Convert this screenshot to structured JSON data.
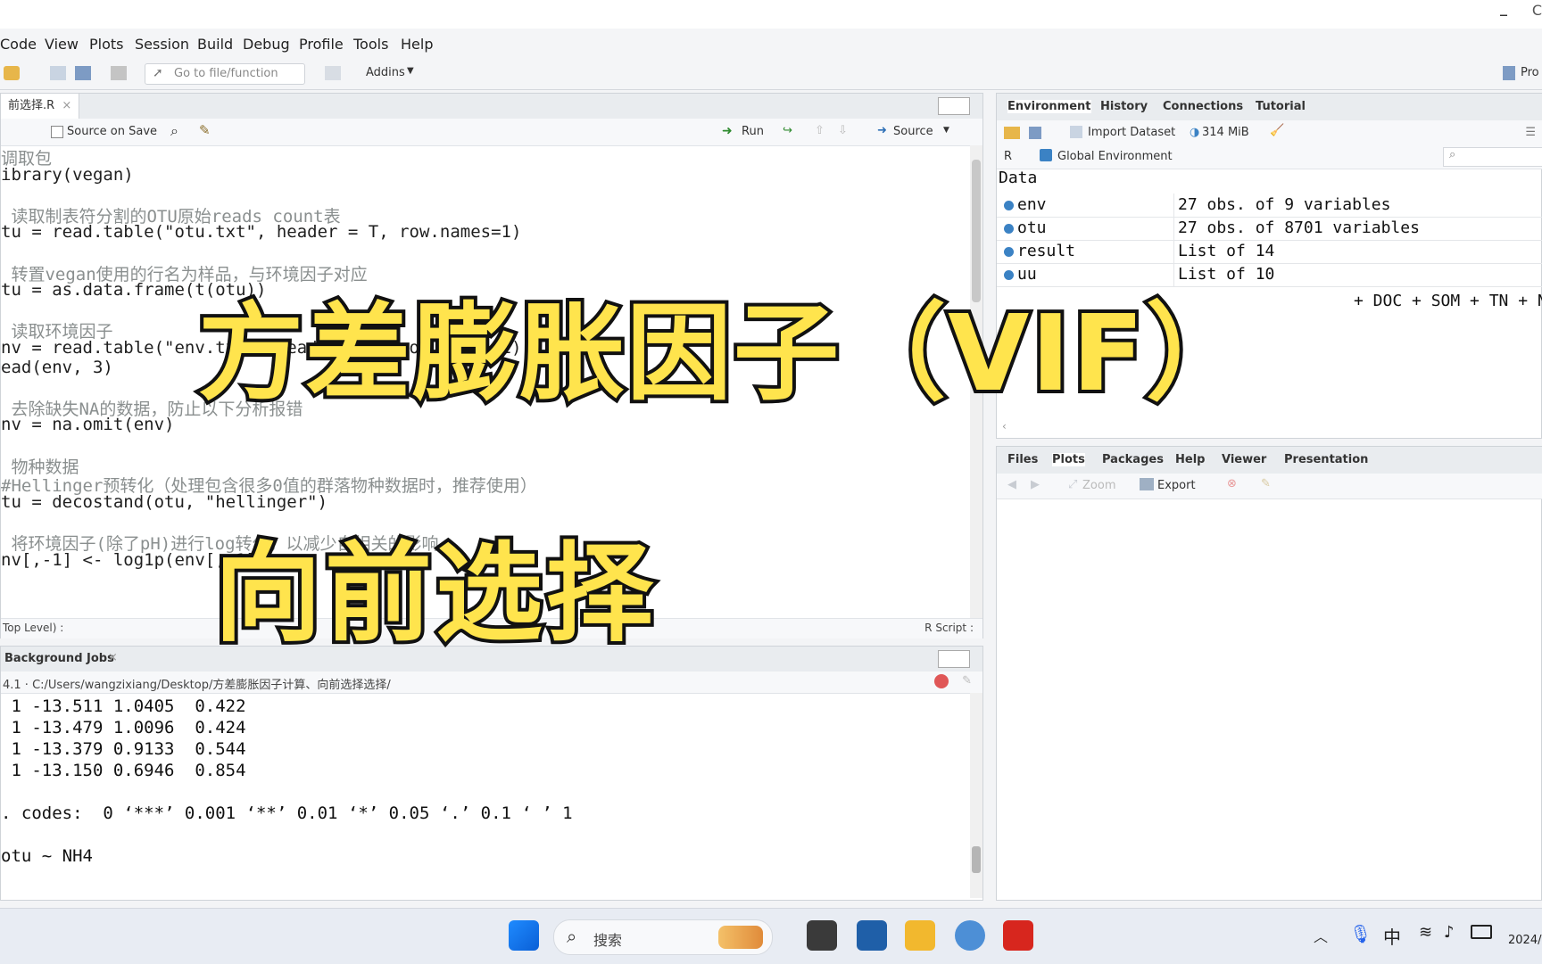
{
  "titlebar": {
    "minimize": "–",
    "extra": "C"
  },
  "menu": [
    "Code",
    "View",
    "Plots",
    "Session",
    "Build",
    "Debug",
    "Profile",
    "Tools",
    "Help"
  ],
  "toolbar": {
    "goto_placeholder": "Go to file/function",
    "addins": "Addins",
    "project": "Pro"
  },
  "editor": {
    "tab_label": "前选择.R",
    "source_on_save": "Source on Save",
    "run": "Run",
    "source": "Source",
    "lines": [
      {
        "t": "调取包",
        "c": "cm"
      },
      {
        "t": "ibrary(vegan)",
        "c": ""
      },
      {
        "t": "",
        "c": ""
      },
      {
        "t": " 读取制表符分割的OTU原始reads count表",
        "c": "cm"
      },
      {
        "t": "tu = read.table(\"otu.txt\", header = T, row.names=1)",
        "c": ""
      },
      {
        "t": "",
        "c": ""
      },
      {
        "t": " 转置vegan使用的行名为样品，与环境因子对应",
        "c": "cm"
      },
      {
        "t": "tu = as.data.frame(t(otu))",
        "c": ""
      },
      {
        "t": "",
        "c": ""
      },
      {
        "t": " 读取环境因子",
        "c": "cm"
      },
      {
        "t": "nv = read.table(\"env.txt\", header = T, row.names=1)",
        "c": ""
      },
      {
        "t": "ead(env, 3)",
        "c": ""
      },
      {
        "t": "",
        "c": ""
      },
      {
        "t": " 去除缺失NA的数据，防止以下分析报错",
        "c": "cm"
      },
      {
        "t": "nv = na.omit(env)",
        "c": ""
      },
      {
        "t": "",
        "c": ""
      },
      {
        "t": " 物种数据",
        "c": "cm"
      },
      {
        "t": "#Hellinger预转化（处理包含很多0值的群落物种数据时，推荐使用）",
        "c": "cm"
      },
      {
        "t": "tu = decostand(otu, \"hellinger\")",
        "c": ""
      },
      {
        "t": "",
        "c": ""
      },
      {
        "t": " 将环境因子(除了pH)进行log转化，以减少自相关的影响",
        "c": "cm"
      },
      {
        "t": "nv[,-1] <- log1p(env[,-1])",
        "c": ""
      }
    ],
    "status_left": "Top Level) :",
    "status_right": "R Script :"
  },
  "console": {
    "tab_label": "Background Jobs",
    "path": "4.1 · C:/Users/wangzixiang/Desktop/方差膨胀因子计算、向前选择选择/",
    "lines": [
      " 1 -13.511 1.0405  0.422",
      " 1 -13.479 1.0096  0.424",
      " 1 -13.379 0.9133  0.544",
      " 1 -13.150 0.6946  0.854",
      "",
      ". codes:  0 ‘***’ 0.001 ‘**’ 0.01 ‘*’ 0.05 ‘.’ 0.1 ‘ ’ 1",
      "",
      "otu ~ NH4"
    ]
  },
  "environment": {
    "tabs": [
      "Environment",
      "History",
      "Connections",
      "Tutorial"
    ],
    "import_dataset": "Import Dataset",
    "memory": "314 MiB",
    "r_label": "R",
    "global_env": "Global Environment",
    "section": "Data",
    "rows": [
      {
        "name": "env",
        "value": "27 obs. of 9 variables"
      },
      {
        "name": "otu",
        "value": "27 obs. of 8701 variables"
      },
      {
        "name": "result",
        "value": "List of  14"
      },
      {
        "name": "uu",
        "value": "List of  10"
      }
    ],
    "formula_tail": "+ DOC + SOM + TN + N"
  },
  "files": {
    "tabs": [
      "Files",
      "Plots",
      "Packages",
      "Help",
      "Viewer",
      "Presentation"
    ],
    "zoom": "Zoom",
    "export": "Export"
  },
  "taskbar": {
    "search": "搜索",
    "ime": "中",
    "date": "2024/"
  },
  "overlay": {
    "title": "方差膨胀因子（VIF）",
    "subtitle": "向前选择"
  }
}
